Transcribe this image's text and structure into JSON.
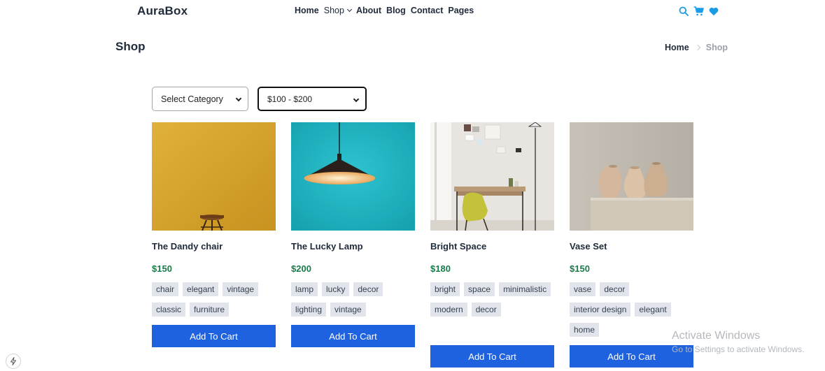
{
  "brand": {
    "logo": "AuraBox"
  },
  "nav": {
    "items": [
      "Home",
      "Shop",
      "About",
      "Blog",
      "Contact",
      "Pages"
    ]
  },
  "header_icons": {
    "search": "search-icon",
    "cart": "cart-icon",
    "wishlist": "heart-icon",
    "accent": "#1a9be6"
  },
  "page": {
    "title": "Shop",
    "breadcrumb": {
      "home": "Home",
      "current": "Shop"
    }
  },
  "filters": {
    "category": {
      "selected": "Select Category"
    },
    "price": {
      "selected": "$100 - $200"
    }
  },
  "products": [
    {
      "name": "The Dandy chair",
      "price": "$150",
      "tags": [
        "chair",
        "elegant",
        "vintage",
        "classic",
        "furniture"
      ],
      "button": "Add To Cart"
    },
    {
      "name": "The Lucky Lamp",
      "price": "$200",
      "tags": [
        "lamp",
        "lucky",
        "decor",
        "lighting",
        "vintage"
      ],
      "button": "Add To Cart"
    },
    {
      "name": "Bright Space",
      "price": "$180",
      "tags": [
        "bright",
        "space",
        "minimalistic",
        "modern",
        "decor"
      ],
      "button": "Add To Cart"
    },
    {
      "name": "Vase Set",
      "price": "$150",
      "tags": [
        "vase",
        "decor",
        "interior design",
        "elegant",
        "home"
      ],
      "button": "Add To Cart"
    }
  ],
  "colors": {
    "price": "#1a7a4a",
    "button": "#1f62e0",
    "tag_bg": "#e1e5eb"
  },
  "watermark": {
    "line1": "Activate Windows",
    "line2": "Go to Settings to activate Windows."
  }
}
